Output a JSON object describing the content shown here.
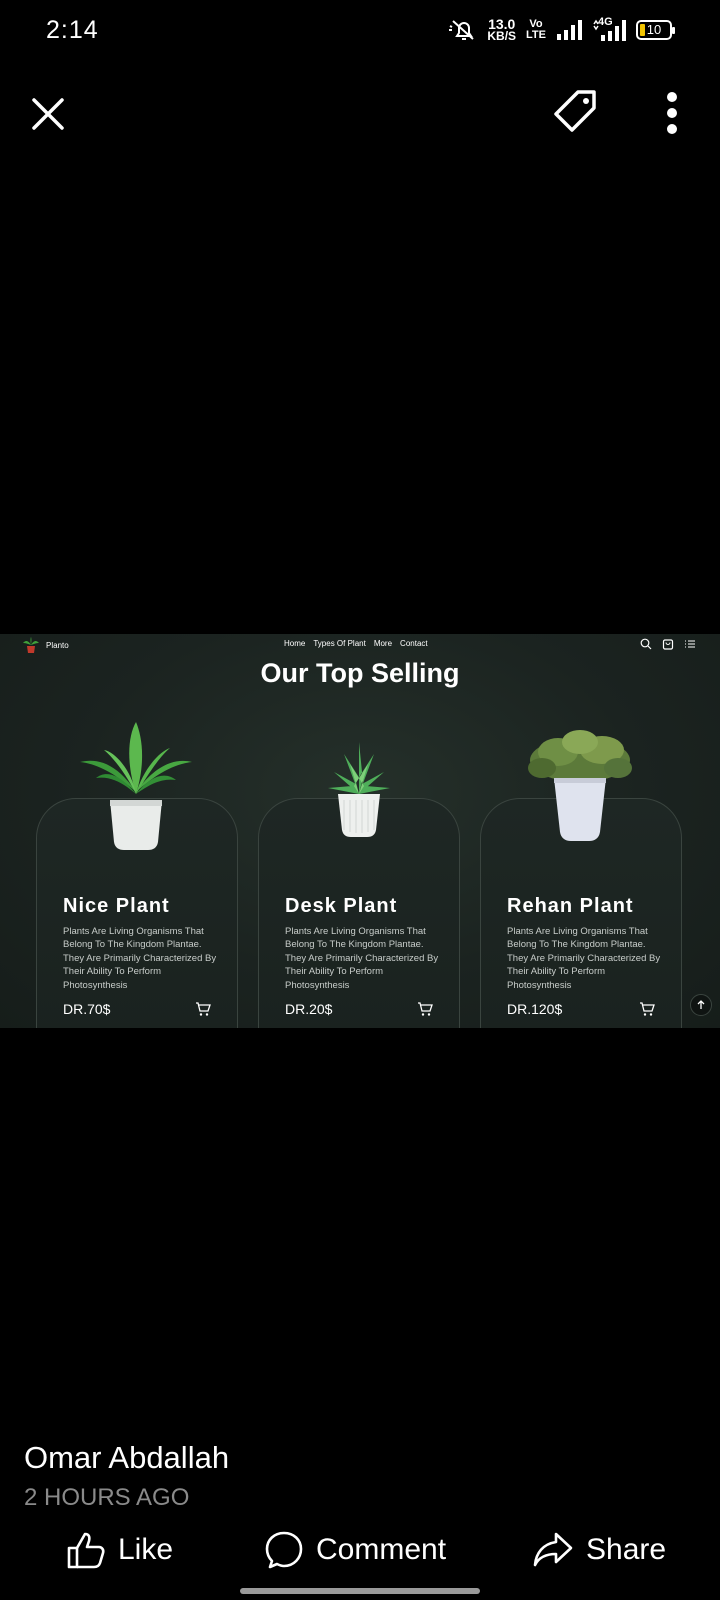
{
  "status_bar": {
    "time": "2:14",
    "net_speed_value": "13.0",
    "net_speed_unit": "KB/S",
    "volte_top": "Vo",
    "volte_bottom": "LTE",
    "network_type": "4G",
    "battery": "10"
  },
  "toolbar": {
    "close_icon": "close-icon",
    "tag_icon": "tag-icon",
    "more_icon": "more-vertical-icon"
  },
  "embedded_site": {
    "brand": "Planto",
    "nav": [
      "Home",
      "Types Of Plant",
      "More",
      "Contact"
    ],
    "nav_icons": [
      "search-icon",
      "bag-icon",
      "menu-icon"
    ],
    "section_title": "Our Top Selling",
    "products": [
      {
        "name": "Nice Plant",
        "description": "Plants Are Living Organisms That Belong To The Kingdom Plantae. They Are Primarily Characterized By Their Ability To Perform Photosynthesis",
        "price": "DR.70$"
      },
      {
        "name": "Desk Plant",
        "description": "Plants Are Living Organisms That Belong To The Kingdom Plantae. They Are Primarily Characterized By Their Ability To Perform Photosynthesis",
        "price": "DR.20$"
      },
      {
        "name": "Rehan Plant",
        "description": "Plants Are Living Organisms That Belong To The Kingdom Plantae. They Are Primarily Characterized By Their Ability To Perform Photosynthesis",
        "price": "DR.120$"
      }
    ]
  },
  "post": {
    "author": "Omar Abdallah",
    "time": "2 HOURS AGO"
  },
  "actions": {
    "like": "Like",
    "comment": "Comment",
    "share": "Share"
  }
}
